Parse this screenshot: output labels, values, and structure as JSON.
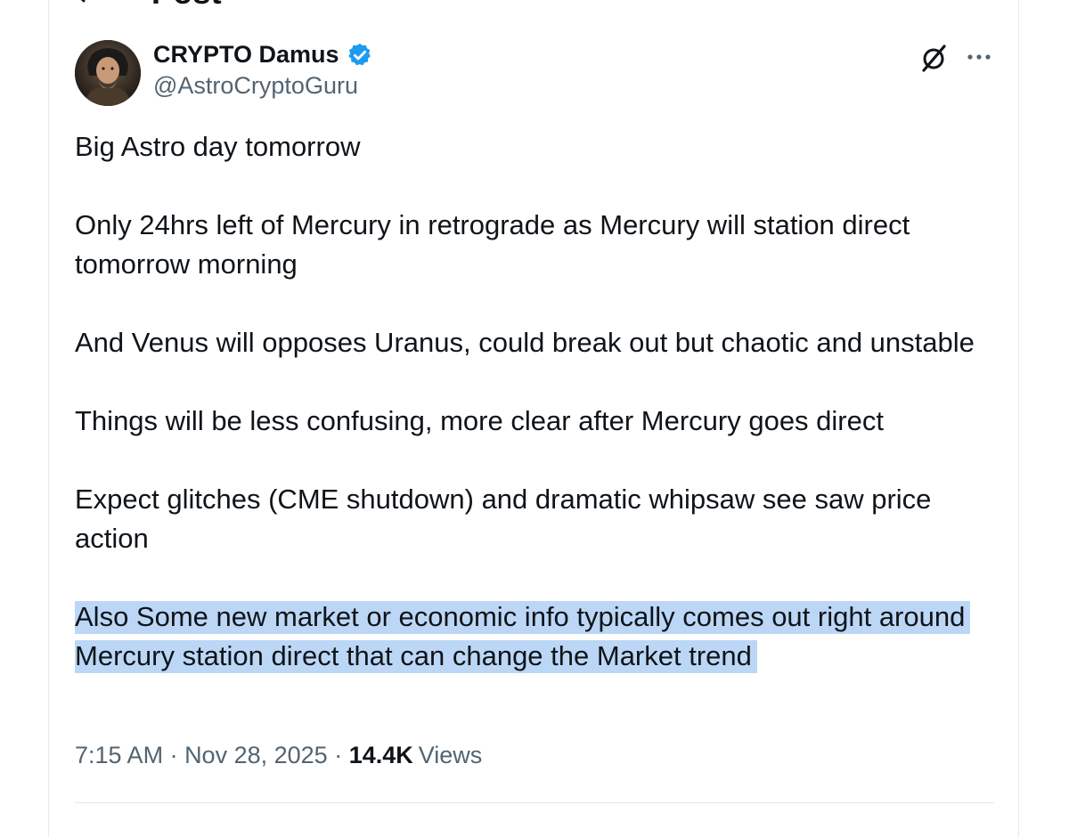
{
  "header": {
    "title": "Post"
  },
  "author": {
    "display_name": "CRYPTO Damus",
    "handle": "@AstroCryptoGuru",
    "verified": true
  },
  "post": {
    "paragraphs": [
      "Big Astro day tomorrow",
      "Only 24hrs left of Mercury in retrograde as Mercury will station direct tomorrow morning",
      "And Venus will opposes Uranus, could break out but chaotic and unstable",
      "Things will be less confusing, more clear after Mercury goes direct",
      "Expect glitches (CME shutdown) and dramatic whipsaw see saw price action"
    ],
    "highlighted_paragraph": "Also Some new market or economic info typically comes out right around Mercury station direct that can change the Market trend"
  },
  "meta": {
    "time": "7:15 AM",
    "sep1": " · ",
    "date": "Nov 28, 2025",
    "sep2": " · ",
    "views_count": "14.4K",
    "views_label": "Views"
  },
  "icons": {
    "back": "back-arrow-icon",
    "verified": "verified-badge-icon",
    "grok": "grok-icon",
    "more": "more-icon"
  },
  "colors": {
    "text": "#0f1419",
    "secondary": "#536471",
    "verified": "#1d9bf0",
    "highlight": "#bcd7f6",
    "border": "#e6e9ec"
  }
}
